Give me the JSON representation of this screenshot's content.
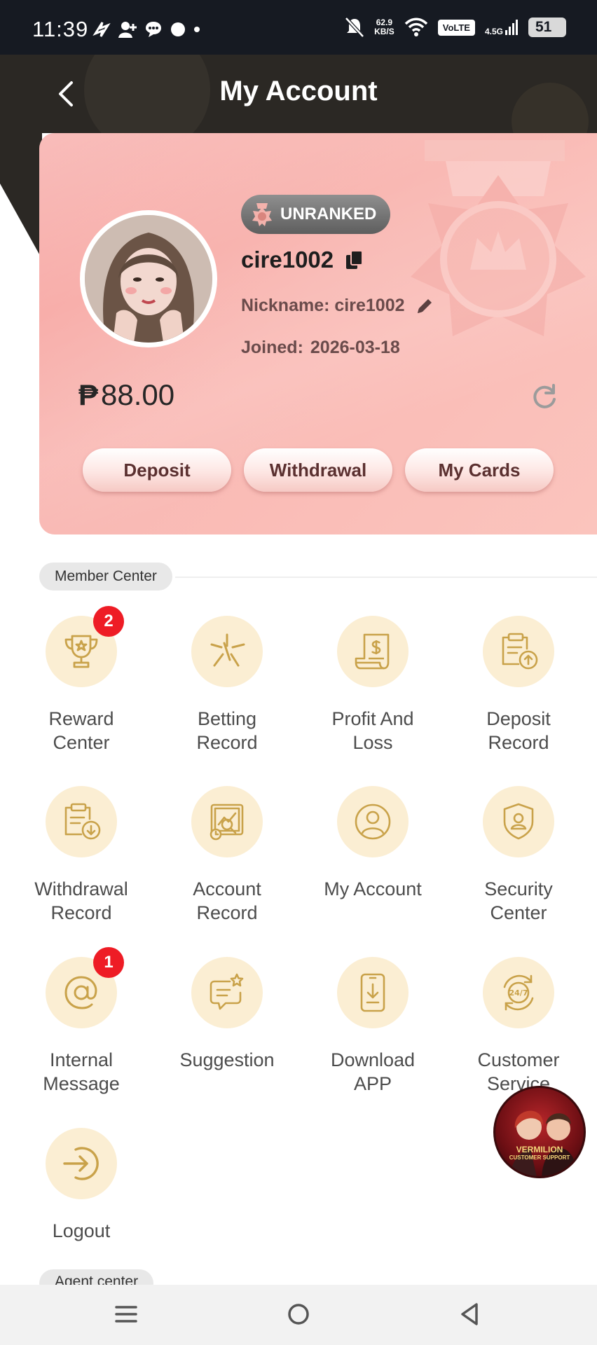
{
  "status_bar": {
    "time": "11:39",
    "net_speed_value": "62.9",
    "net_speed_unit": "KB/S",
    "volte": "VoLTE",
    "network": "4.5G",
    "battery": "51"
  },
  "header": {
    "title": "My Account",
    "back_icon": "chevron-left-icon"
  },
  "profile": {
    "rank": "UNRANKED",
    "username": "cire1002",
    "nickname_label": "Nickname:",
    "nickname": "cire1002",
    "joined_label": "Joined:",
    "joined_date": "2026-03-18",
    "currency_symbol": "₱",
    "balance": "88.00",
    "actions": {
      "deposit": "Deposit",
      "withdrawal": "Withdrawal",
      "my_cards": "My Cards"
    },
    "colors": {
      "card": "#f9b9b4",
      "accent": "#c9a24a"
    }
  },
  "member_center": {
    "title": "Member Center",
    "items": [
      {
        "label": "Reward Center",
        "icon": "trophy-icon",
        "badge": "2"
      },
      {
        "label": "Betting Record",
        "icon": "sparkle-icon"
      },
      {
        "label": "Profit And Loss",
        "icon": "receipt-dollar-icon"
      },
      {
        "label": "Deposit Record",
        "icon": "clipboard-upload-icon"
      },
      {
        "label": "Withdrawal Record",
        "icon": "clipboard-download-icon"
      },
      {
        "label": "Account Record",
        "icon": "account-chart-icon"
      },
      {
        "label": "My Account",
        "icon": "user-circle-icon"
      },
      {
        "label": "Security Center",
        "icon": "shield-user-icon"
      },
      {
        "label": "Internal Message",
        "icon": "at-sign-icon",
        "badge": "1"
      },
      {
        "label": "Suggestion",
        "icon": "chat-star-icon"
      },
      {
        "label": "Download APP",
        "icon": "phone-download-icon"
      },
      {
        "label": "Customer Service",
        "icon": "support-24-7-icon"
      },
      {
        "label": "Logout",
        "icon": "logout-icon"
      }
    ]
  },
  "floating_support": {
    "line1": "VERMILION",
    "line2": "CUSTOMER SUPPORT"
  },
  "agent_center": {
    "title": "Agent center"
  }
}
